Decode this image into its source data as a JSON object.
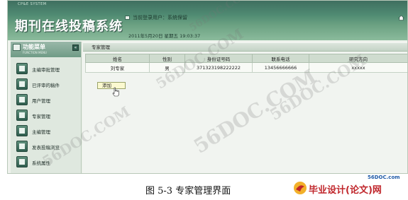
{
  "header": {
    "brand_small": "CP&E SYSTEM",
    "title": "期刊在线投稿系统",
    "current_user": "当前登录用户：系统保留",
    "datetime": "2011年5月20日 星期五  19:03:37"
  },
  "sidebar": {
    "menu_title": "功能菜单",
    "menu_subtitle": "FUNCTION MENU",
    "toggle_symbol": "«",
    "items": [
      {
        "label": "主编审批管理"
      },
      {
        "label": "已评审的稿件"
      },
      {
        "label": "用户管理"
      },
      {
        "label": "专家管理"
      },
      {
        "label": "主编管理"
      },
      {
        "label": "发表投稿浏览"
      },
      {
        "label": "系统属性"
      }
    ]
  },
  "main": {
    "panel_title": "专家管理",
    "table": {
      "headers": [
        "姓名",
        "性别",
        "身份证号码",
        "联系电话",
        "研究方向"
      ],
      "rows": [
        [
          "刘专家",
          "男",
          "371323198222222",
          "13456666666",
          "xxxxx"
        ]
      ]
    },
    "add_button": "添加"
  },
  "watermarks": [
    "56DOC.COM",
    "56DOC.COM",
    "56DOC.COM",
    "56DOC.COM",
    "56DOC.COM"
  ],
  "caption": "图 5-3 专家管理界面",
  "logo": {
    "site": "56DOC.com",
    "text": "毕业设计(论文)网"
  },
  "colors": {
    "header_green": "#4f8a72",
    "accent_red": "#c0262b",
    "site_blue": "#1f5aa8"
  }
}
